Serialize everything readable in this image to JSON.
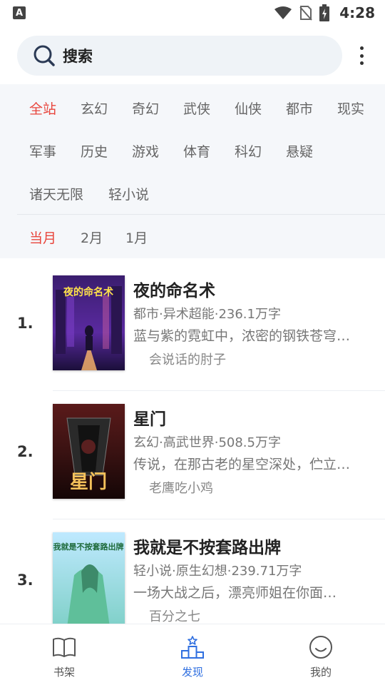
{
  "status_bar": {
    "app_badge": "A",
    "time": "4:28"
  },
  "search": {
    "label": "搜索"
  },
  "filters": {
    "categories": [
      "全站",
      "玄幻",
      "奇幻",
      "武侠",
      "仙侠",
      "都市",
      "现实",
      "军事",
      "历史",
      "游戏",
      "体育",
      "科幻",
      "悬疑",
      "诸天无限",
      "轻小说"
    ],
    "active_category": "全站",
    "periods": [
      "当月",
      "2月",
      "1月"
    ],
    "active_period": "当月"
  },
  "books": [
    {
      "rank": "1.",
      "title": "夜的命名术",
      "meta": "都市·异术超能·236.1万字",
      "desc": "蓝与紫的霓虹中，浓密的钢铁苍穹…",
      "author": "会说话的肘子",
      "cover_text": "夜的命名术"
    },
    {
      "rank": "2.",
      "title": "星门",
      "meta": "玄幻·高武世界·508.5万字",
      "desc": "传说，在那古老的星空深处，伫立…",
      "author": "老鹰吃小鸡",
      "cover_text": "星门"
    },
    {
      "rank": "3.",
      "title": "我就是不按套路出牌",
      "meta": "轻小说·原生幻想·239.71万字",
      "desc": "一场大战之后，漂亮师姐在你面…",
      "author": "百分之七",
      "cover_text": "我就是不按套路出牌"
    }
  ],
  "bottom_nav": [
    {
      "label": "书架",
      "icon": "book-icon"
    },
    {
      "label": "发现",
      "icon": "podium-icon"
    },
    {
      "label": "我的",
      "icon": "smile-icon"
    }
  ],
  "bottom_nav_active": "发现",
  "colors": {
    "accent_red": "#e8453c",
    "accent_blue": "#2f6fe0",
    "panel_bg": "#f5f7fa"
  }
}
